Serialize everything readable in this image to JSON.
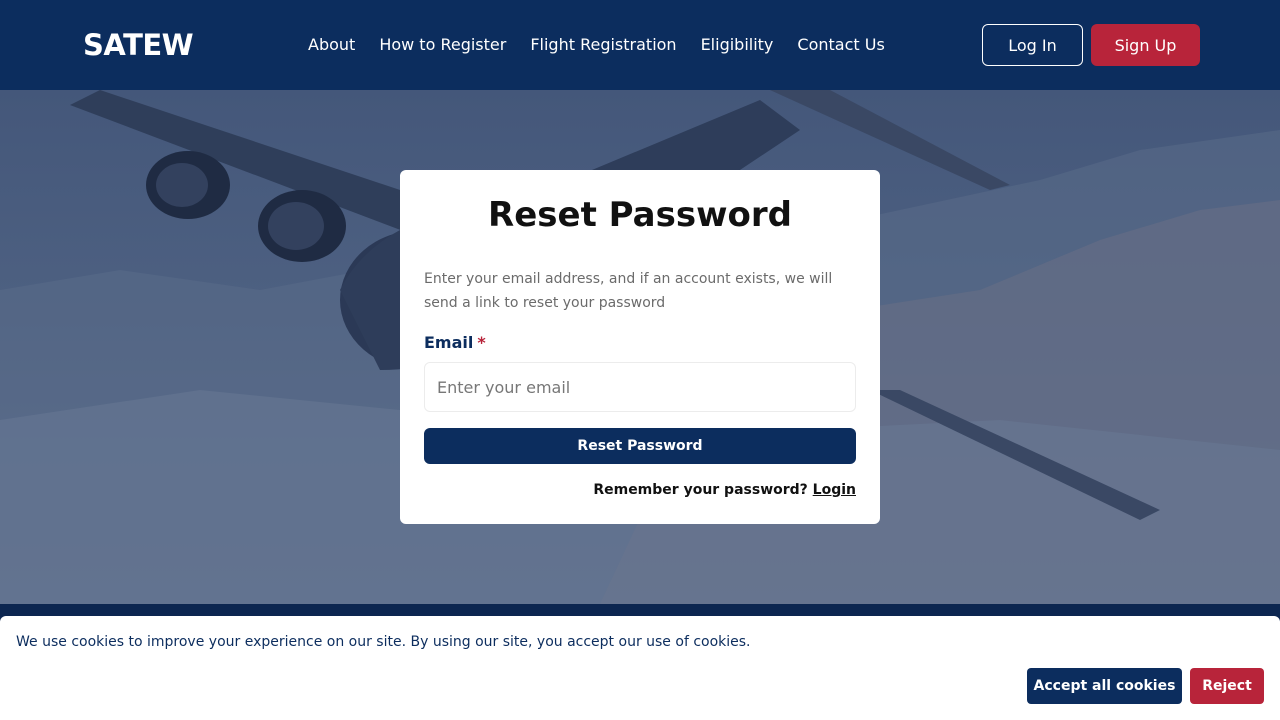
{
  "header": {
    "logo": "SATEW",
    "nav": [
      "About",
      "How to Register",
      "Flight Registration",
      "Eligibility",
      "Contact Us"
    ],
    "login_label": "Log In",
    "signup_label": "Sign Up"
  },
  "card": {
    "title": "Reset Password",
    "description": "Enter your email address, and if an account exists, we will send a link to reset your password",
    "email_label": "Email",
    "required_mark": "*",
    "email_placeholder": "Enter your email",
    "email_value": "",
    "submit_label": "Reset Password",
    "remember_text": "Remember your password?",
    "login_link": "Login"
  },
  "cookie": {
    "text": "We use cookies to improve your experience on our site. By using our site, you accept our use of cookies.",
    "accept_label": "Accept all cookies",
    "reject_label": "Reject"
  },
  "colors": {
    "brand_navy": "#0c2d5e",
    "brand_red": "#b8243a"
  }
}
